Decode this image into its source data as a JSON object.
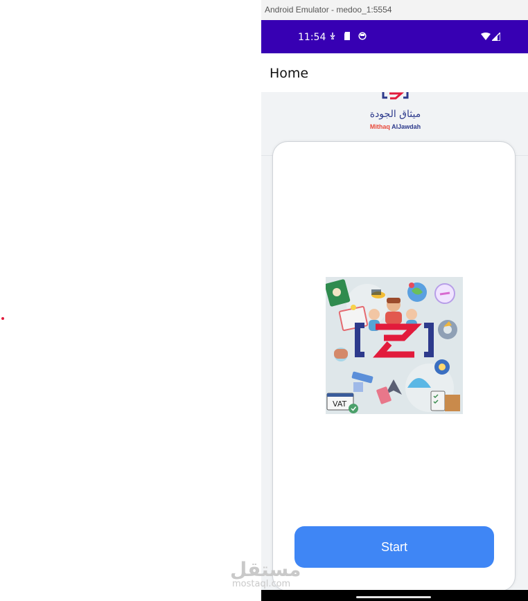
{
  "window": {
    "title": "Android Emulator - medoo_1:5554"
  },
  "status_bar": {
    "time": "11:54"
  },
  "app_bar": {
    "title": "Home"
  },
  "logo": {
    "arabic": "ميثاق الجودة",
    "english_1": "Mithaq",
    "english_2": "AlJawdah"
  },
  "main_image": {
    "label": "VAT"
  },
  "start_button": {
    "label": "Start"
  },
  "watermark": {
    "arabic": "مستقل",
    "english": "mostaql.com"
  },
  "colors": {
    "status_bar": "#3700b3",
    "button": "#3f86f5",
    "brand_red": "#e21b3c",
    "brand_blue": "#2d3a8c"
  }
}
